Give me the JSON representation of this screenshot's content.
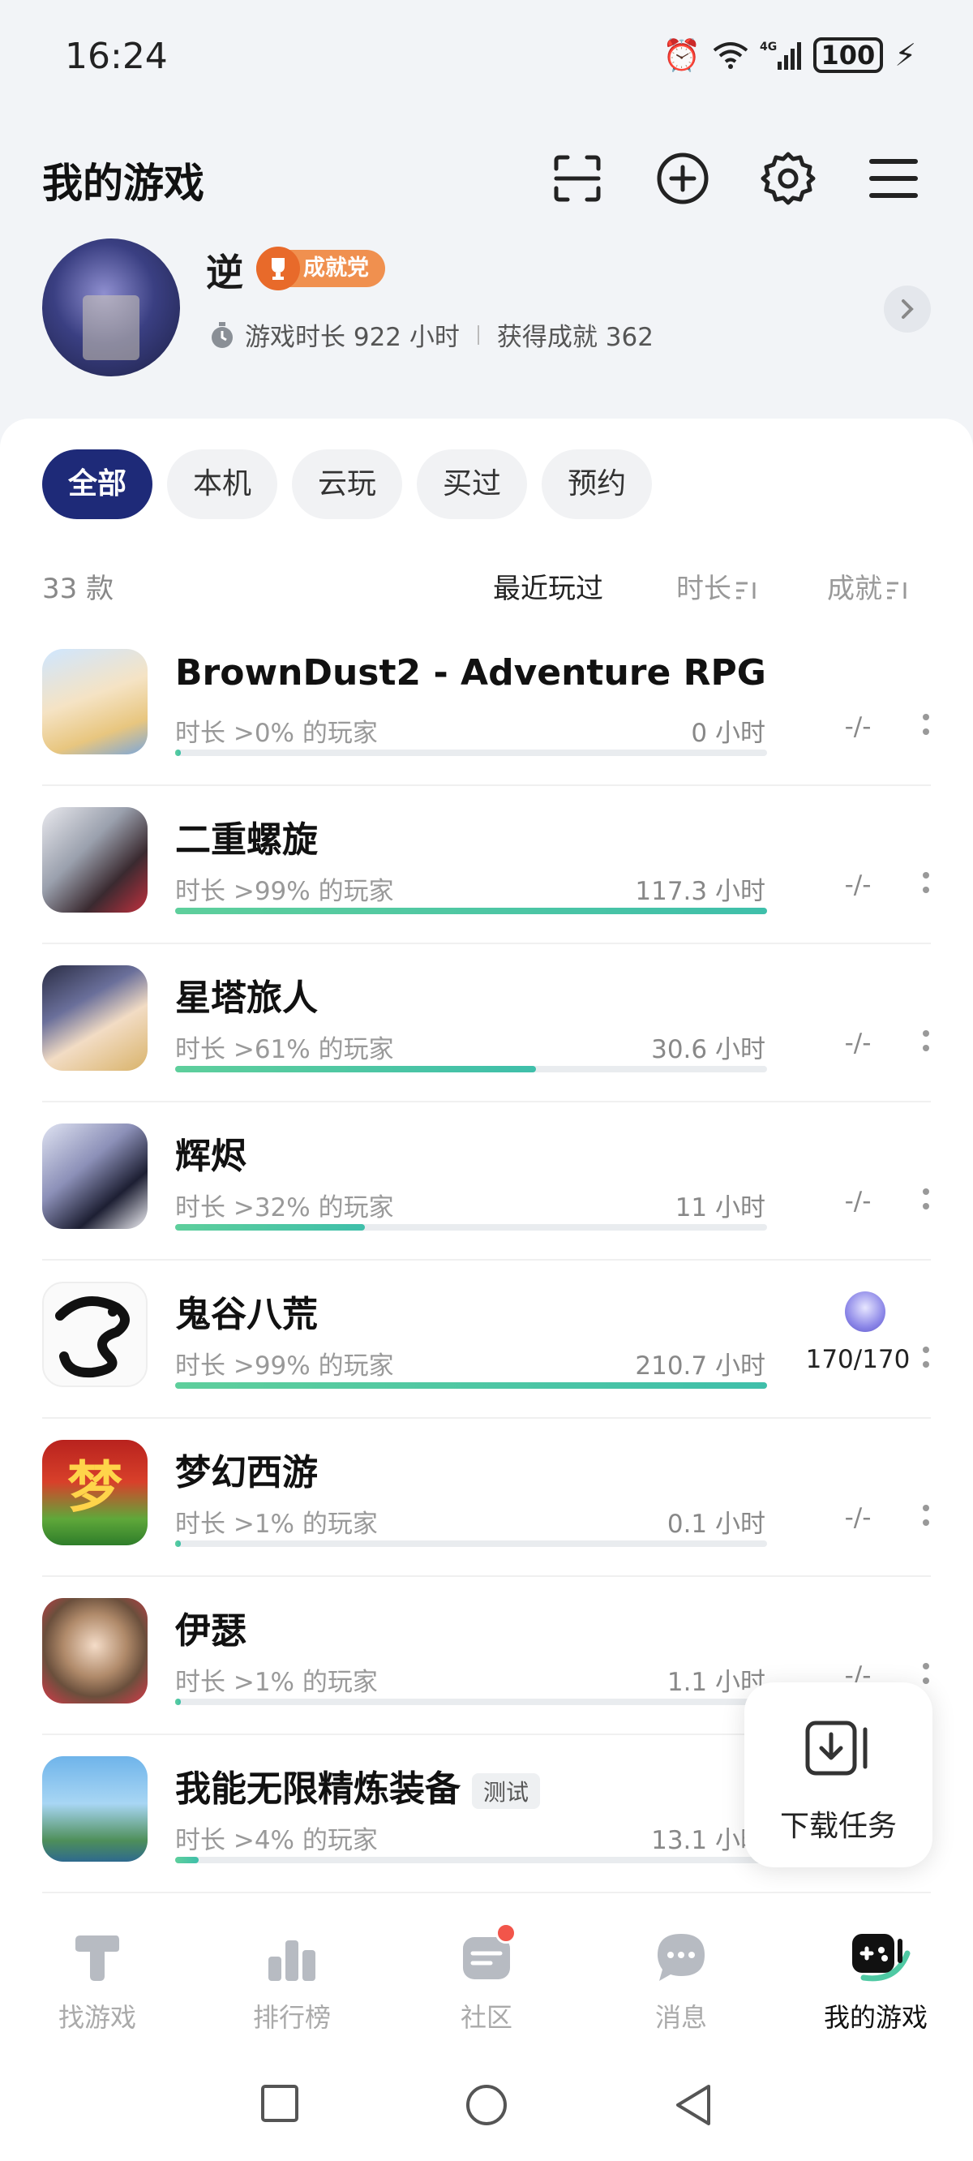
{
  "status_bar": {
    "time": "16:24",
    "battery": "100"
  },
  "header": {
    "title": "我的游戏"
  },
  "profile": {
    "username": "逆",
    "badge": "成就党",
    "playtime_label": "游戏时长 922 小时",
    "achievements_label": "获得成就 362"
  },
  "tabs": [
    {
      "label": "全部",
      "active": true
    },
    {
      "label": "本机",
      "active": false
    },
    {
      "label": "云玩",
      "active": false
    },
    {
      "label": "买过",
      "active": false
    },
    {
      "label": "预约",
      "active": false
    }
  ],
  "sort": {
    "count": "33 款",
    "recent": "最近玩过",
    "duration": "时长",
    "achievement": "成就"
  },
  "games": [
    {
      "name": "BrownDust2 - Adventure RPG",
      "pct_label": "时长 >0% 的玩家",
      "hours": "0 小时",
      "progress": 0.01,
      "achievement": "-/-",
      "tag": ""
    },
    {
      "name": "二重螺旋",
      "pct_label": "时长 >99% 的玩家",
      "hours": "117.3 小时",
      "progress": 1.0,
      "achievement": "-/-",
      "tag": ""
    },
    {
      "name": "星塔旅人",
      "pct_label": "时长 >61% 的玩家",
      "hours": "30.6 小时",
      "progress": 0.61,
      "achievement": "-/-",
      "tag": ""
    },
    {
      "name": "辉烬",
      "pct_label": "时长 >32% 的玩家",
      "hours": "11 小时",
      "progress": 0.32,
      "achievement": "-/-",
      "tag": ""
    },
    {
      "name": "鬼谷八荒",
      "pct_label": "时长 >99% 的玩家",
      "hours": "210.7 小时",
      "progress": 1.0,
      "achievement": "170/170",
      "tag": ""
    },
    {
      "name": "梦幻西游",
      "pct_label": "时长 >1% 的玩家",
      "hours": "0.1 小时",
      "progress": 0.01,
      "achievement": "-/-",
      "tag": ""
    },
    {
      "name": "伊瑟",
      "pct_label": "时长 >1% 的玩家",
      "hours": "1.1 小时",
      "progress": 0.01,
      "achievement": "-/-",
      "tag": ""
    },
    {
      "name": "我能无限精炼装备",
      "pct_label": "时长 >4% 的玩家",
      "hours": "13.1 小时",
      "progress": 0.04,
      "achievement": "",
      "tag": "测试"
    }
  ],
  "download": {
    "label": "下载任务"
  },
  "bottom_nav": [
    {
      "label": "找游戏",
      "icon": "find-games-icon",
      "active": false
    },
    {
      "label": "排行榜",
      "icon": "ranking-icon",
      "active": false
    },
    {
      "label": "社区",
      "icon": "community-icon",
      "active": false
    },
    {
      "label": "消息",
      "icon": "messages-icon",
      "active": false
    },
    {
      "label": "我的游戏",
      "icon": "my-games-icon",
      "active": true
    }
  ],
  "colors": {
    "accent": "#1e2a78",
    "progress": "#4fc9a3",
    "badge": "#f0904f",
    "notif": "#f2554a"
  }
}
